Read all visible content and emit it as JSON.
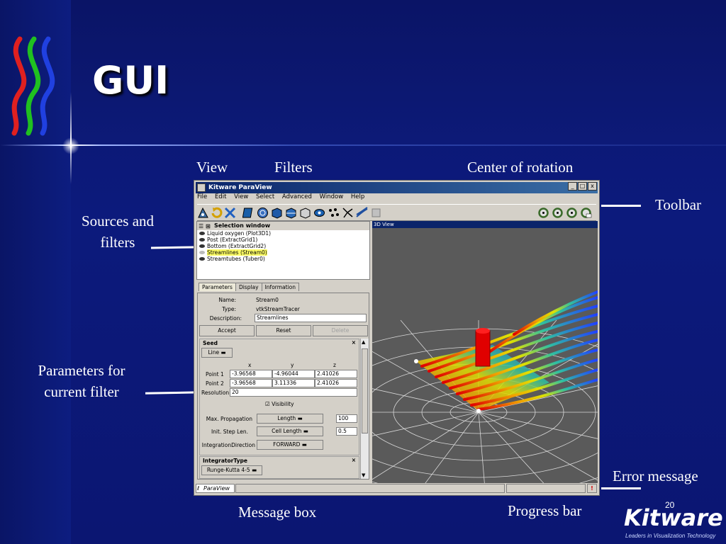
{
  "slide": {
    "title": "GUI",
    "page_number": "20",
    "logo_brand": "Kitware",
    "logo_tagline": "Leaders in Visualization Technology",
    "colors": {
      "background": "#0c1a7c",
      "text": "#ffffff"
    }
  },
  "callouts": {
    "view": "View",
    "filters": "Filters",
    "center_of_rotation": "Center of rotation",
    "toolbar": "Toolbar",
    "sources_filters_line1": "Sources and",
    "sources_filters_line2": "filters",
    "params_line1": "Parameters for",
    "params_line2": "current filter",
    "error_message": "Error message",
    "message_box": "Message box",
    "progress_bar": "Progress bar"
  },
  "window": {
    "title": "Kitware ParaView",
    "controls": {
      "minimize": "_",
      "maximize": "□",
      "close": "x"
    },
    "menu": [
      "File",
      "Edit",
      "View",
      "Select",
      "Advanced",
      "Window",
      "Help"
    ],
    "selection_window": {
      "title": "Selection window",
      "items": [
        "Liquid oxygen (Plot3D1)",
        "Post (ExtractGrid1)",
        "Bottom (ExtractGrid2)",
        "Streamlines (Stream0)",
        "Streamtubes (Tuber0)"
      ]
    },
    "tabs": [
      "Parameters",
      "Display",
      "Information"
    ],
    "parameters": {
      "name_label": "Name:",
      "name_value": "Stream0",
      "type_label": "Type:",
      "type_value": "vtkStreamTracer",
      "description_label": "Description:",
      "description_value": "Streamlines",
      "accept": "Accept",
      "reset": "Reset",
      "delete": "Delete",
      "seed": {
        "title": "Seed",
        "close": "×",
        "shape": "Line",
        "col_headers": [
          "x",
          "y",
          "z"
        ],
        "point1_label": "Point 1",
        "point1": [
          "-3.96568",
          "-4.96044",
          "2.41026"
        ],
        "point2_label": "Point 2",
        "point2": [
          "-3.96568",
          "3.11336",
          "2.41026"
        ],
        "resolution_label": "Resolution",
        "resolution_value": "20",
        "visibility_check": "☑",
        "visibility_label": "Visibility"
      },
      "max_propagation_label": "Max. Propagation",
      "max_propagation_unit": "Length",
      "max_propagation_value": "100",
      "init_step_label": "Init. Step Len.",
      "init_step_unit": "Cell Length",
      "init_step_value": "0.5",
      "integration_direction_label": "IntegrationDirection",
      "integration_direction_value": "FORWARD",
      "integrator_type_title": "IntegratorType",
      "integrator_type_close": "×",
      "integrator_value": "Runge-Kutta 4-5"
    },
    "view_title": "3D View",
    "status": {
      "message_box": "ParaView",
      "error_icon": "!"
    }
  }
}
